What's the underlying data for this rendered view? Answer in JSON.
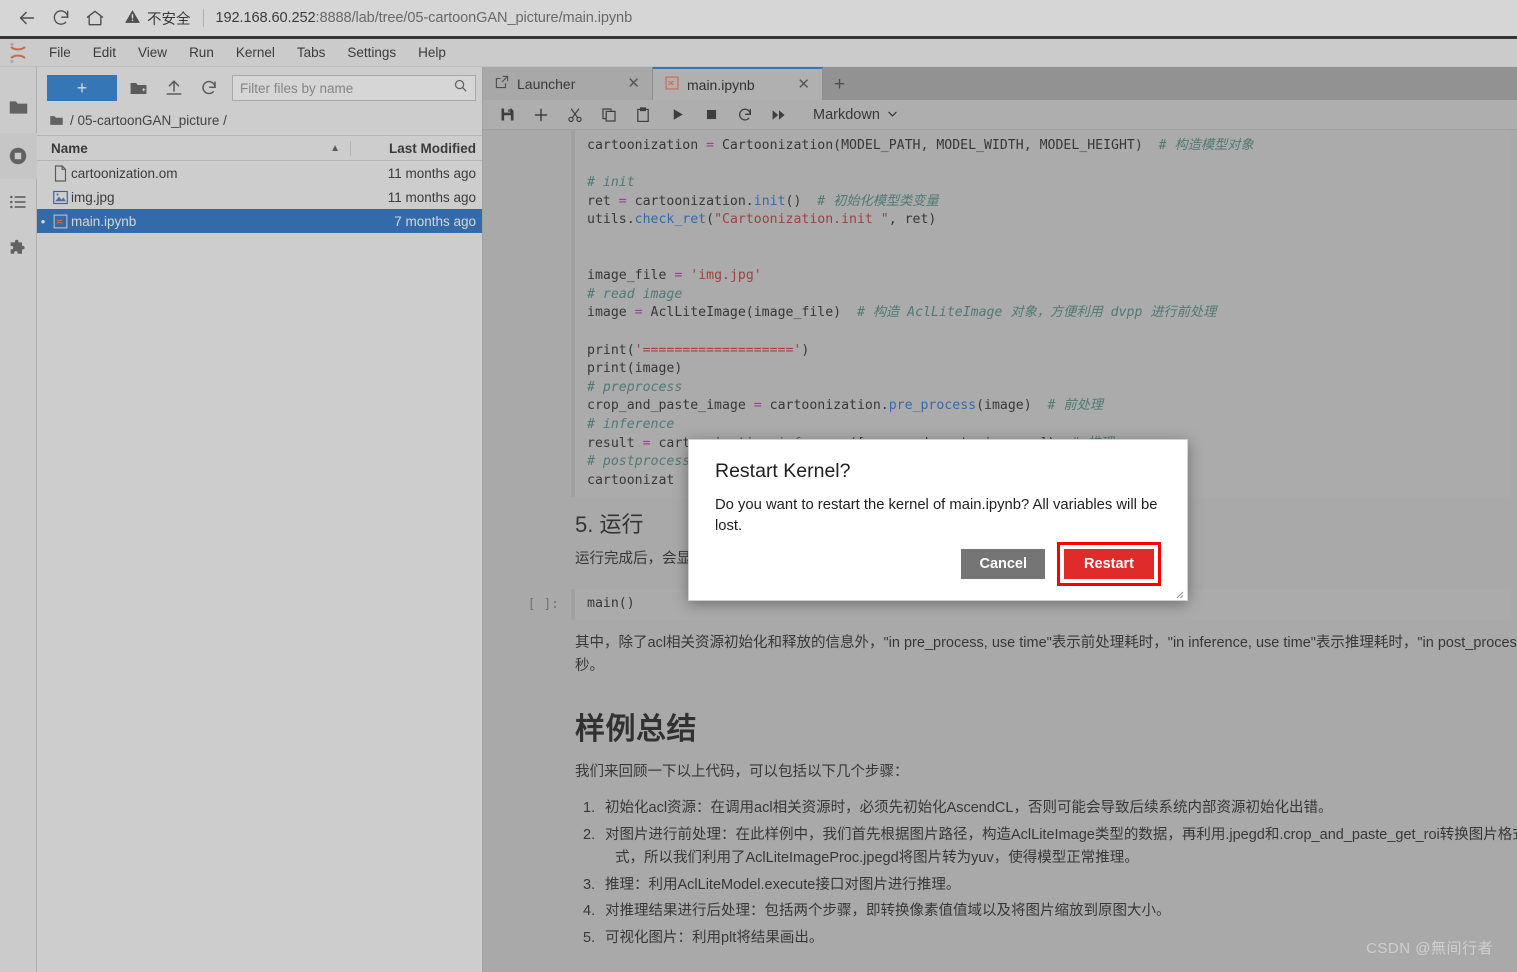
{
  "browser": {
    "back_icon": "arrow-left-icon",
    "reload_icon": "reload-icon",
    "home_icon": "home-icon",
    "security_icon": "warning-triangle-icon",
    "security_label": "不安全",
    "url_host": "192.168.60.252",
    "url_rest": ":8888/lab/tree/05-cartoonGAN_picture/main.ipynb"
  },
  "menubar": {
    "items": [
      "File",
      "Edit",
      "View",
      "Run",
      "Kernel",
      "Tabs",
      "Settings",
      "Help"
    ]
  },
  "activity_bar": {
    "items": [
      {
        "name": "file-browser-icon",
        "label": "Files"
      },
      {
        "name": "running-kernels-icon",
        "label": "Running Terminals and Kernels"
      },
      {
        "name": "table-of-contents-icon",
        "label": "Table of Contents"
      },
      {
        "name": "extension-manager-icon",
        "label": "Extension Manager"
      }
    ]
  },
  "filebrowser": {
    "new_button": "+",
    "new_folder_icon": "new-folder-icon",
    "upload_icon": "upload-icon",
    "refresh_icon": "refresh-icon",
    "filter_placeholder": "Filter files by name",
    "filter_value": "",
    "search_icon": "search-icon",
    "breadcrumb": "/ 05-cartoonGAN_picture /",
    "columns": {
      "name": "Name",
      "modified": "Last Modified"
    },
    "sort_caret": "▲",
    "rows": [
      {
        "icon": "generic-file-icon",
        "name": "cartoonization.om",
        "modified": "11 months ago",
        "selected": false,
        "dot": ""
      },
      {
        "icon": "image-file-icon",
        "name": "img.jpg",
        "modified": "11 months ago",
        "selected": false,
        "dot": ""
      },
      {
        "icon": "notebook-file-icon",
        "name": "main.ipynb",
        "modified": "7 months ago",
        "selected": true,
        "dot": "•"
      }
    ]
  },
  "tabs": [
    {
      "label": "Launcher",
      "icon": "launcher-icon",
      "close": "✕",
      "active": false
    },
    {
      "label": "main.ipynb",
      "icon": "notebook-file-icon",
      "close": "✕",
      "active": true
    }
  ],
  "tab_add": "+",
  "notebook_toolbar": {
    "icons": [
      "save-icon",
      "add-cell-icon",
      "cut-icon",
      "copy-icon",
      "paste-icon",
      "run-icon",
      "stop-icon",
      "restart-icon",
      "restart-run-all-icon"
    ],
    "cell_type": "Markdown",
    "cell_type_caret": "⌄"
  },
  "notebook": {
    "code_cell_lines": [
      "cartoonization = Cartoonization(MODEL_PATH, MODEL_WIDTH, MODEL_HEIGHT)  # 构造模型对象",
      "",
      "# init",
      "ret = cartoonization.init()  # 初始化模型类变量",
      "utils.check_ret(\"Cartoonization.init \", ret)",
      "",
      "",
      "image_file = 'img.jpg'",
      "# read image",
      "image = AclLiteImage(image_file)  # 构造 AclLiteImage 对象，方便利用 dvpp 进行前处理",
      "",
      "print('==================')",
      "print(image)",
      "# preprocess",
      "crop_and_paste_image = cartoonization.pre_process(image)  # 前处理",
      "# inference",
      "result = cartoonization.inference([crop_and_paste_image, ])  # 推理",
      "# postprocess",
      "cartoonizat"
    ],
    "section_heading": "5. 运行",
    "section_paragraph": "运行完成后，会显",
    "main_cell_prompt": "[ ]:",
    "main_cell_code": "main()",
    "after_cell_paragraph_line1": "其中，除了acl相关资源初始化和释放的信息外，\"in pre_process, use time\"表示前处理耗时，\"in inference, use time\"表示推理耗时，\"in post_process",
    "after_cell_paragraph_line2": "秒。",
    "summary_heading": "样例总结",
    "summary_intro": "我们来回顾一下以上代码，可以包括以下几个步骤：",
    "summary_items": [
      {
        "num": "1.",
        "text": "初始化acl资源：在调用acl相关资源时，必须先初始化AscendCL，否则可能会导致后续系统内部资源初始化出错。"
      },
      {
        "num": "2.",
        "text": "对图片进行前处理：在此样例中，我们首先根据图片路径，构造AclLiteImage类型的数据，再利用.jpegd和.crop_and_paste_get_roi转换图片格式、",
        "text2": "式，所以我们利用了AclLiteImageProc.jpegd将图片转为yuv，使得模型正常推理。"
      },
      {
        "num": "3.",
        "text": "推理：利用AclLiteModel.execute接口对图片进行推理。"
      },
      {
        "num": "4.",
        "text": "对推理结果进行后处理：包括两个步骤，即转换像素值值域以及将图片缩放到原图大小。"
      },
      {
        "num": "5.",
        "text": "可视化图片：利用plt将结果画出。"
      }
    ]
  },
  "dialog": {
    "title": "Restart Kernel?",
    "body": "Do you want to restart the kernel of main.ipynb? All variables will be lost.",
    "cancel_label": "Cancel",
    "restart_label": "Restart",
    "highlight_color": "#ff0000",
    "restart_color": "#e02b2b",
    "cancel_color": "#757575"
  },
  "watermark": "CSDN @無间行者"
}
